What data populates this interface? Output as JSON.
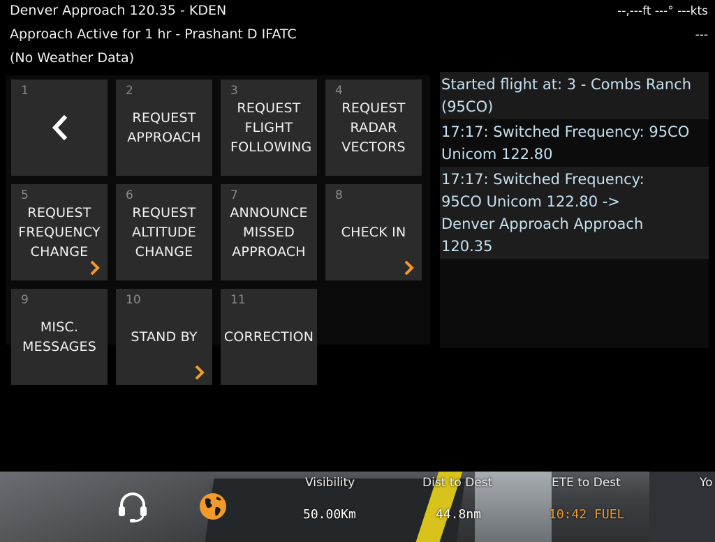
{
  "header": {
    "frequency_line": "Denver Approach 120.35 - KDEN",
    "session_line": "Approach Active for 1 hr - Prashant D IFATC",
    "weather_line": "(No Weather Data)",
    "telemetry": "--,---ft  ---° ---kts",
    "telemetry_sub": "---"
  },
  "menu": {
    "tiles": [
      {
        "num": "1",
        "label": "",
        "icon": "chevron-left-icon"
      },
      {
        "num": "2",
        "label": "REQUEST APPROACH"
      },
      {
        "num": "3",
        "label": "REQUEST FLIGHT FOLLOWING"
      },
      {
        "num": "4",
        "label": "REQUEST RADAR VECTORS"
      },
      {
        "num": "5",
        "label": "REQUEST FREQUENCY CHANGE",
        "icon": "chevron-right-icon"
      },
      {
        "num": "6",
        "label": "REQUEST ALTITUDE CHANGE"
      },
      {
        "num": "7",
        "label": "ANNOUNCE MISSED APPROACH"
      },
      {
        "num": "8",
        "label": "CHECK IN",
        "icon": "chevron-right-icon"
      },
      {
        "num": "9",
        "label": "MISC. MESSAGES"
      },
      {
        "num": "10",
        "label": "STAND BY",
        "icon": "chevron-right-icon"
      },
      {
        "num": "11",
        "label": "CORRECTION"
      }
    ]
  },
  "log": {
    "entries": [
      "Started flight at: 3 - Combs Ranch (95CO)",
      "17:17: Switched Frequency: 95CO Unicom 122.80",
      "17:17: Switched Frequency: 95CO Unicom 122.80 -> Denver Approach Approach 120.35"
    ]
  },
  "bottom_bar": {
    "atc_icon": "headset-icon",
    "map_icon": "globe-icon",
    "visibility": {
      "title": "Visibility",
      "value": "50.00Km"
    },
    "dist_to_dest": {
      "title": "Dist to Dest",
      "value": "44.8nm"
    },
    "ete_to_dest": {
      "title": "ETE to Dest",
      "value": "10:42 FUEL"
    },
    "truncated_title": "Yo"
  },
  "colors": {
    "accent_orange": "#f39a2b",
    "log_text": "#c6e0f0",
    "tile_bg": "#2b2b2b"
  }
}
